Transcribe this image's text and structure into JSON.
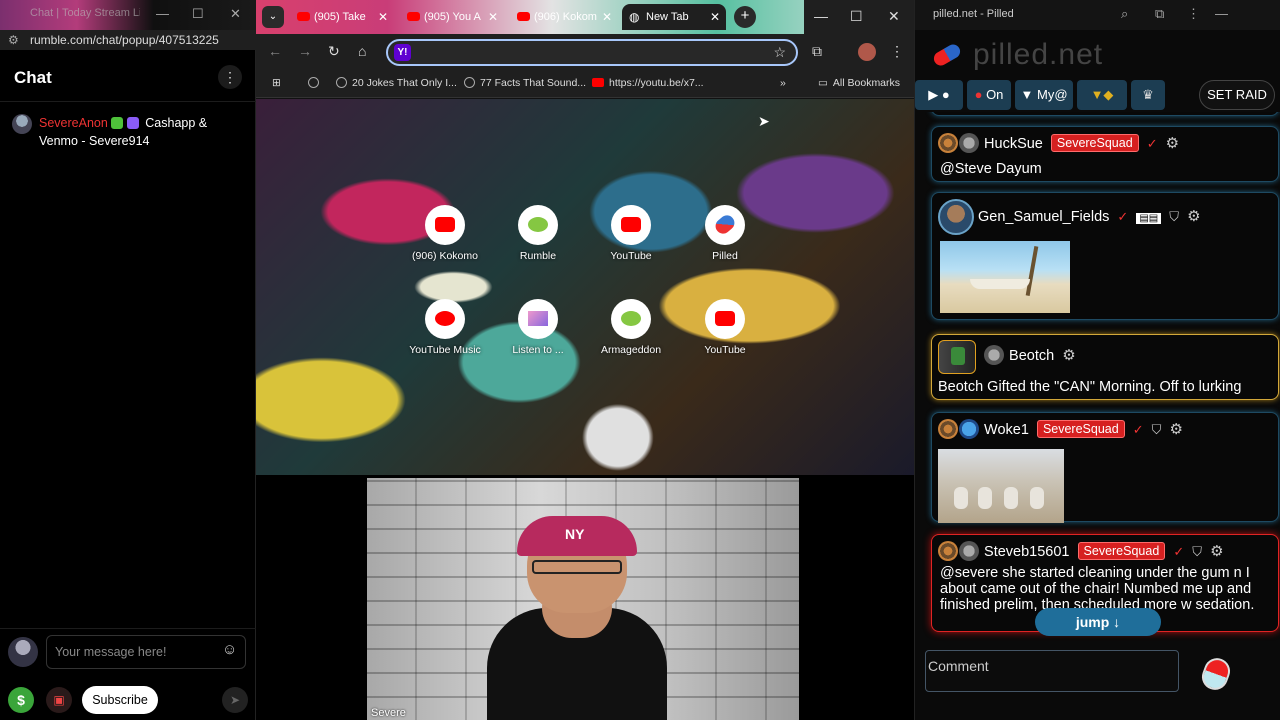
{
  "left_window": {
    "title": "Chat | Today Stream Live...",
    "controls": [
      "—",
      "☐",
      "✕"
    ],
    "url": "rumble.com/chat/popup/407513225",
    "chat_title": "Chat",
    "message": {
      "user": "SevereAnon",
      "text": "Cashapp & Venmo - Severe914"
    },
    "compose_placeholder": "Your message here!",
    "dollar": "$",
    "subscribe": "Subscribe"
  },
  "browser": {
    "tabs": [
      {
        "label": "(905) Take",
        "active": false
      },
      {
        "label": "(905) You A",
        "active": false
      },
      {
        "label": "(906) Kokom",
        "active": false
      },
      {
        "label": "New Tab",
        "active": true
      }
    ],
    "window_controls": [
      "—",
      "☐",
      "✕"
    ],
    "bookmarks": [
      "20 Jokes That Only I...",
      "77 Facts That Sound...",
      "https://youtu.be/x7..."
    ],
    "all_bookmarks": "All Bookmarks",
    "shortcuts": [
      {
        "label": "(906) Kokomo",
        "icon": "yt"
      },
      {
        "label": "Rumble",
        "icon": "rum"
      },
      {
        "label": "YouTube",
        "icon": "yt"
      },
      {
        "label": "Pilled",
        "icon": "pill"
      },
      {
        "label": "YouTube Music",
        "icon": "ytm"
      },
      {
        "label": "Listen to ...",
        "icon": "img"
      },
      {
        "label": "Armageddon",
        "icon": "rum"
      },
      {
        "label": "YouTube",
        "icon": "yt"
      }
    ]
  },
  "webcam": {
    "cap_text": "NY",
    "name": "Severe"
  },
  "right_window": {
    "title": "pilled.net - Pilled",
    "logo": "pilled.net",
    "nav": {
      "on": "On",
      "my": "My@",
      "set_raid": "SET RAID"
    },
    "posts": [
      {
        "user": "HuckSue",
        "badge": "SevereSquad",
        "text": "@Steve Dayum"
      },
      {
        "user": "Gen_Samuel_Fields",
        "badge": "",
        "text": ""
      },
      {
        "user": "Beotch",
        "badge": "",
        "text": "Beotch Gifted the \"CAN\" Morning. Off to lurking"
      },
      {
        "user": "Woke1",
        "badge": "SevereSquad",
        "text": ""
      },
      {
        "user": "Steveb15601",
        "badge": "SevereSquad",
        "text": "@severe she started cleaning under the gum n I about came out of the chair! Numbed me up and finished prelim, then scheduled more w sedation."
      }
    ],
    "jump": "jump ↓",
    "comment_placeholder": "Comment"
  },
  "colors": {
    "squad_red": "#d62020",
    "card_blue": "#1e4a62",
    "card_gold": "#d3a83a",
    "rumble_green": "#85c742"
  }
}
